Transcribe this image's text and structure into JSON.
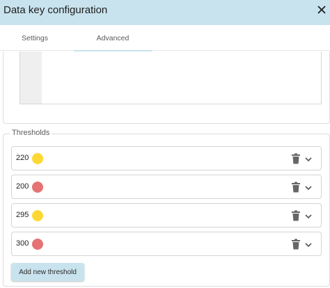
{
  "dialog": {
    "title": "Data key configuration"
  },
  "tabs": [
    {
      "label": "Settings",
      "selected": false
    },
    {
      "label": "Advanced",
      "selected": true
    }
  ],
  "thresholds": {
    "legend": "Thresholds",
    "items": [
      {
        "value": "220",
        "color": "#fdd835"
      },
      {
        "value": "200",
        "color": "#e57373"
      },
      {
        "value": "295",
        "color": "#fdd835"
      },
      {
        "value": "300",
        "color": "#e57373"
      }
    ],
    "add_label": "Add new threshold"
  },
  "colors": {
    "header": "#c9e3ee",
    "accent": "#c9e3ee"
  }
}
